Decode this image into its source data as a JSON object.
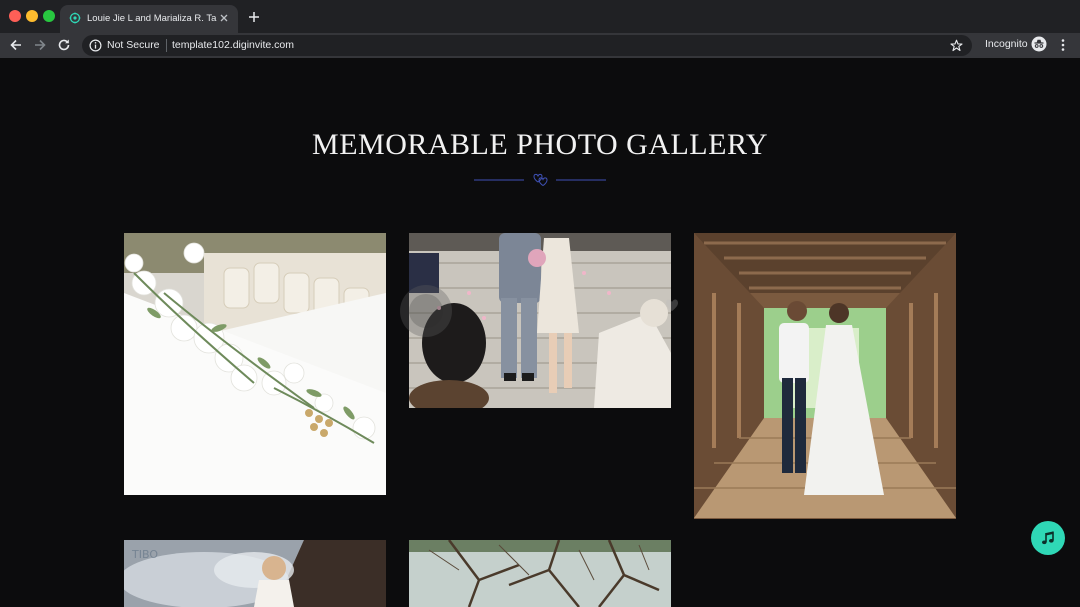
{
  "browser": {
    "tab_title": "Louie Jie L and Marializa R. Tabe",
    "security_label": "Not Secure",
    "url": "template102.diginvite.com",
    "incognito_label": "Incognito"
  },
  "gallery": {
    "title": "MEMORABLE PHOTO GALLERY",
    "photos": [
      {
        "subject": "table with white flowers"
      },
      {
        "subject": "couple walking down steps"
      },
      {
        "subject": "couple kissing on covered bridge"
      },
      {
        "subject": "bride in smoke"
      },
      {
        "subject": "trees reflected in water"
      }
    ]
  },
  "colors": {
    "accent": "#2fd8b6",
    "divider": "#3f51b5",
    "background": "#0c0c0d"
  },
  "icons": [
    "back-icon",
    "forward-icon",
    "reload-icon",
    "info-icon",
    "star-icon",
    "incognito-icon",
    "menu-icon",
    "music-note-icon"
  ]
}
